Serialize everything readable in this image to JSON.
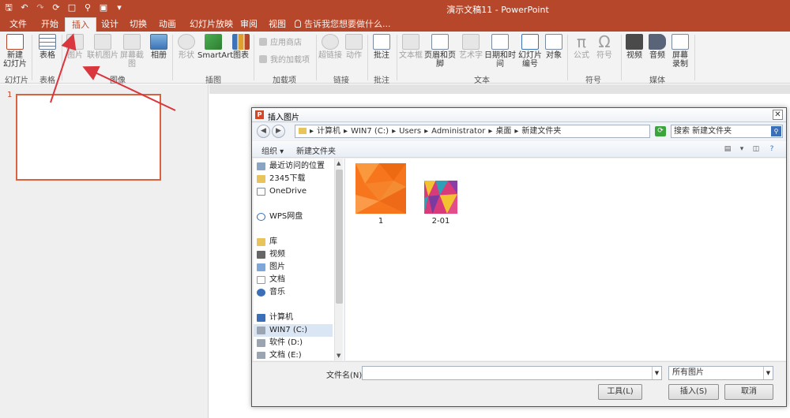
{
  "titlebar": {
    "title": "演示文稿11 - PowerPoint",
    "qat_icons": [
      "save-icon",
      "undo-icon",
      "redo-icon",
      "repeat-icon",
      "new-file-icon",
      "print-preview-icon",
      "screen-icon",
      "customize-icon"
    ]
  },
  "tabs": [
    {
      "label": "文件"
    },
    {
      "label": "开始"
    },
    {
      "label": "插入"
    },
    {
      "label": "设计"
    },
    {
      "label": "切换"
    },
    {
      "label": "动画"
    },
    {
      "label": "幻灯片放映"
    },
    {
      "label": "审阅"
    },
    {
      "label": "视图"
    }
  ],
  "active_tab": "插入",
  "tell_me": "告诉我您想要做什么...",
  "ribbon": {
    "new_slide": "新建\n幻灯片",
    "table": "表格",
    "picture": "图片",
    "online_picture": "联机图片",
    "screenshot": "屏幕截图",
    "album": "相册",
    "shape": "形状",
    "smartart": "SmartArt",
    "chart": "图表",
    "app_store": "应用商店",
    "my_addins": "我的加载项",
    "hyperlink": "超链接",
    "action": "动作",
    "comment": "批注",
    "textbox": "文本框",
    "header_footer": "页眉和页脚",
    "wordart": "艺术字",
    "date_time": "日期和时间",
    "slide_number": "幻灯片\n编号",
    "object": "对象",
    "equation": "公式",
    "symbol": "符号",
    "video": "视频",
    "audio": "音频",
    "screen_record": "屏幕\n录制",
    "groups": {
      "slides": "幻灯片",
      "tables": "表格",
      "images": "图像",
      "illustrations": "插图",
      "addins": "加载项",
      "links": "链接",
      "comments": "批注",
      "text": "文本",
      "symbols": "符号",
      "media": "媒体"
    }
  },
  "slides_pane": {
    "slide_number": "1"
  },
  "dialog": {
    "title": "插入图片",
    "path": [
      "计算机",
      "WIN7 (C:)",
      "Users",
      "Administrator",
      "桌面",
      "新建文件夹"
    ],
    "search_placeholder": "搜索 新建文件夹",
    "toolbar": {
      "organize": "组织 ▾",
      "new_folder": "新建文件夹"
    },
    "nav_items": [
      {
        "label": "最近访问的位置",
        "icon": "recent-icon"
      },
      {
        "label": "2345下载",
        "icon": "folder-icon"
      },
      {
        "label": "OneDrive",
        "icon": "onedrive-icon"
      },
      {
        "label": "WPS网盘",
        "icon": "cloud-icon"
      },
      {
        "label": "库",
        "icon": "library-icon"
      },
      {
        "label": "视频",
        "icon": "video-icon"
      },
      {
        "label": "图片",
        "icon": "picture-icon"
      },
      {
        "label": "文档",
        "icon": "document-icon"
      },
      {
        "label": "音乐",
        "icon": "music-icon"
      },
      {
        "label": "计算机",
        "icon": "computer-icon"
      },
      {
        "label": "WIN7 (C:)",
        "icon": "drive-icon"
      },
      {
        "label": "软件 (D:)",
        "icon": "drive-icon"
      },
      {
        "label": "文档 (E:)",
        "icon": "drive-icon"
      }
    ],
    "files": [
      {
        "name": "1",
        "colors": [
          "#f7761d",
          "#f39a3a"
        ]
      },
      {
        "name": "2-01",
        "colors": [
          "#d93a7a",
          "#f2c230"
        ]
      }
    ],
    "filename_label": "文件名(N):",
    "filename_value": "",
    "filetype_value": "所有图片",
    "tools_button": "工具(L)",
    "insert_button": "插入(S)",
    "cancel_button": "取消"
  },
  "colors": {
    "accent": "#b7472a",
    "arrow": "#d9363e",
    "highlight": "#d9633f"
  }
}
